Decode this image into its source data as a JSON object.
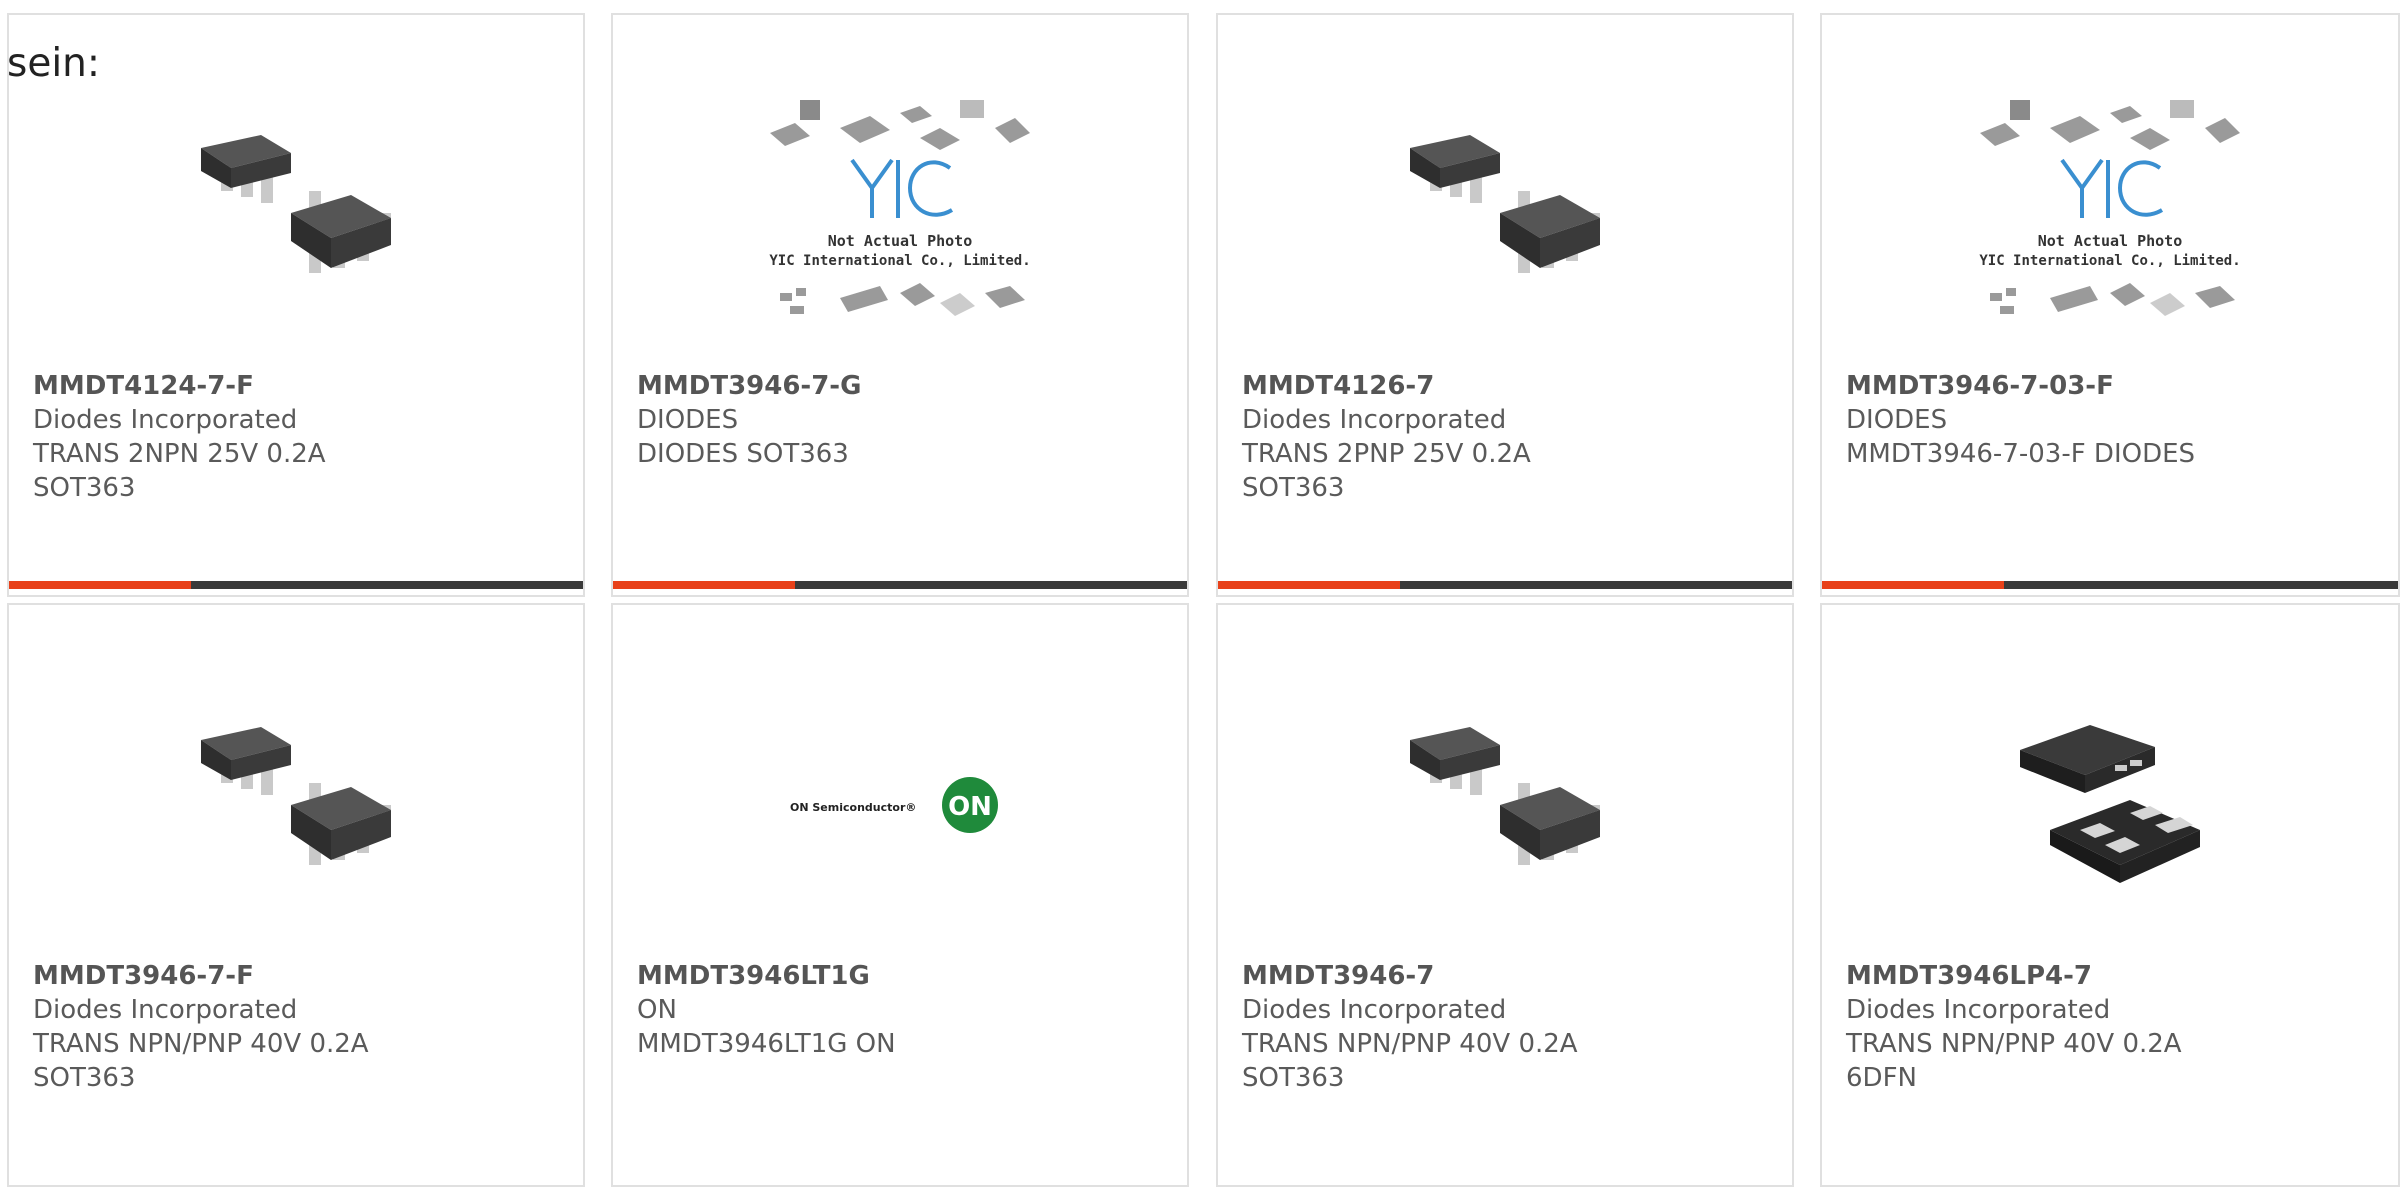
{
  "lead_text": "sein:",
  "colors": {
    "accent": "#e8411a",
    "bar": "#3a3a3a",
    "border": "#e0e0e0"
  },
  "products": [
    {
      "part": "MMDT4124-7-F",
      "manufacturer": "Diodes Incorporated",
      "description": "TRANS 2NPN 25V 0.2A SOT363",
      "image": "sot363-package"
    },
    {
      "part": "MMDT3946-7-G",
      "manufacturer": "DIODES",
      "description": "DIODES SOT363",
      "image": "yic-placeholder",
      "placeholder_lines": [
        "Not Actual Photo",
        "YIC International Co., Limited."
      ]
    },
    {
      "part": "MMDT4126-7",
      "manufacturer": "Diodes Incorporated",
      "description": "TRANS 2PNP 25V 0.2A SOT363",
      "image": "sot363-package"
    },
    {
      "part": "MMDT3946-7-03-F",
      "manufacturer": "DIODES",
      "description": "MMDT3946-7-03-F DIODES",
      "image": "yic-placeholder",
      "placeholder_lines": [
        "Not Actual Photo",
        "YIC International Co., Limited."
      ]
    },
    {
      "part": "MMDT3946-7-F",
      "manufacturer": "Diodes Incorporated",
      "description": "TRANS NPN/PNP 40V 0.2A SOT363",
      "image": "sot363-package"
    },
    {
      "part": "MMDT3946LT1G",
      "manufacturer": "ON",
      "description": "MMDT3946LT1G ON",
      "image": "on-semi-logo",
      "logo_text": "ON Semiconductor®",
      "logo_badge": "ON"
    },
    {
      "part": "MMDT3946-7",
      "manufacturer": "Diodes Incorporated",
      "description": "TRANS NPN/PNP 40V 0.2A SOT363",
      "image": "sot363-package"
    },
    {
      "part": "MMDT3946LP4-7",
      "manufacturer": "Diodes Incorporated",
      "description": "TRANS NPN/PNP 40V 0.2A 6DFN",
      "image": "dfn-package"
    }
  ]
}
